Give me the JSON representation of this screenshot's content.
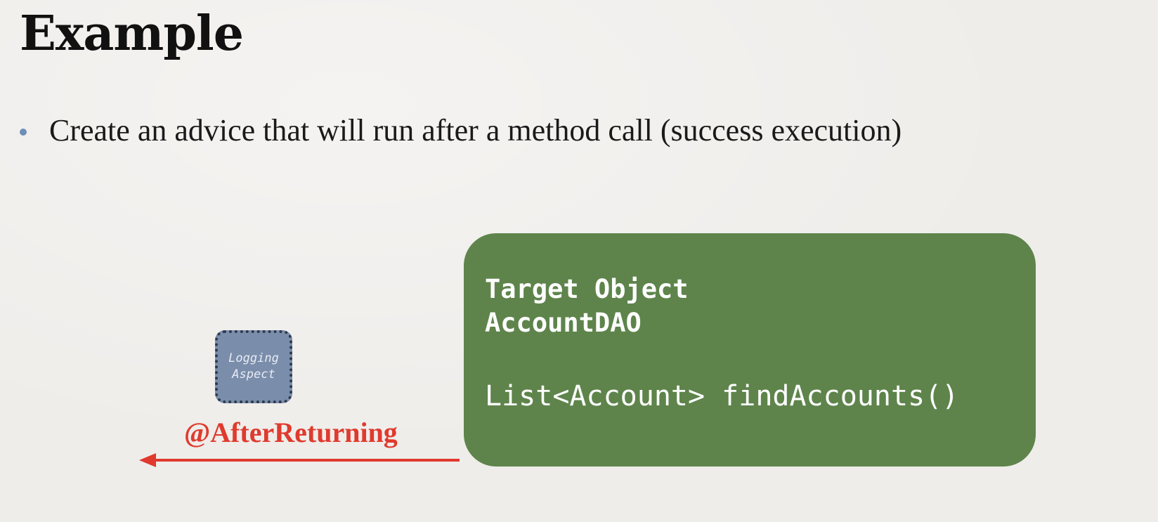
{
  "slide": {
    "title": "Example",
    "bullets": [
      "Create an advice that will run after a method call (success execution)"
    ]
  },
  "diagram": {
    "target": {
      "title": "Target Object",
      "name": "AccountDAO",
      "method": "List<Account> findAccounts()",
      "color": "#5e844b"
    },
    "aspect": {
      "line1": "Logging",
      "line2": "Aspect",
      "color": "#7a8dab"
    },
    "advice": {
      "label": "@AfterReturning",
      "color": "#e03a2e"
    }
  }
}
